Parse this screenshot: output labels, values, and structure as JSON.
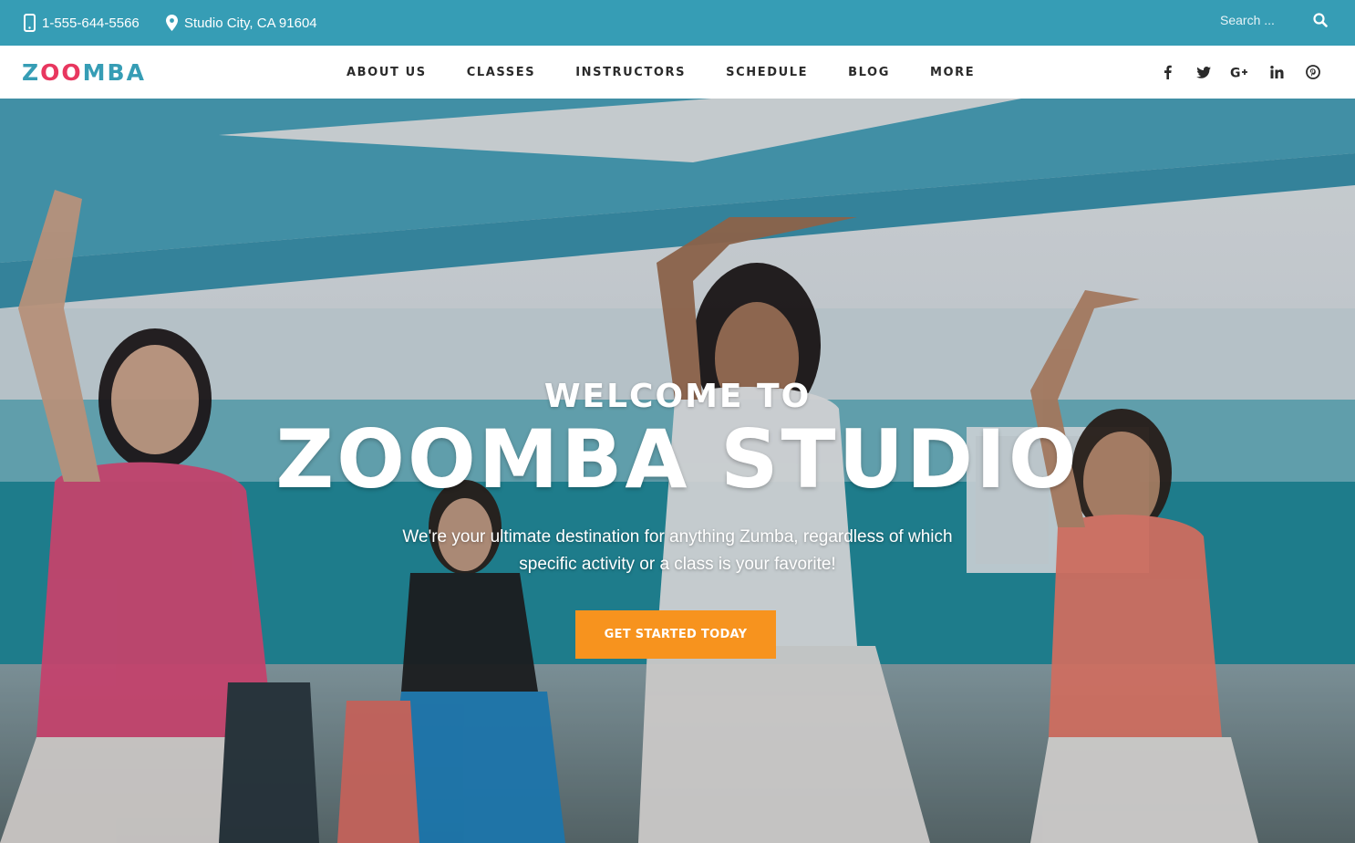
{
  "topbar": {
    "phone": "1-555-644-5566",
    "address": "Studio City, CA 91604",
    "search_placeholder": "Search ...",
    "background_color": "#369db5"
  },
  "nav": {
    "logo_prefix": "Z",
    "logo_highlight": "OO",
    "logo_suffix": "MBA",
    "items": [
      "ABOUT US",
      "CLASSES",
      "INSTRUCTORS",
      "SCHEDULE",
      "BLOG",
      "MORE"
    ],
    "socials": [
      "facebook-icon",
      "twitter-icon",
      "google-plus-icon",
      "linkedin-icon",
      "pinterest-icon"
    ],
    "logo_colors": {
      "primary": "#369db5",
      "accent": "#e8375f"
    }
  },
  "hero": {
    "pretitle": "WELCOME TO",
    "title": "ZOOMBA STUDIO",
    "description": "We're your ultimate destination for anything Zumba, regardless of which specific activity or a class is your favorite!",
    "cta_label": "GET STARTED TODAY",
    "cta_color": "#f7931e"
  }
}
